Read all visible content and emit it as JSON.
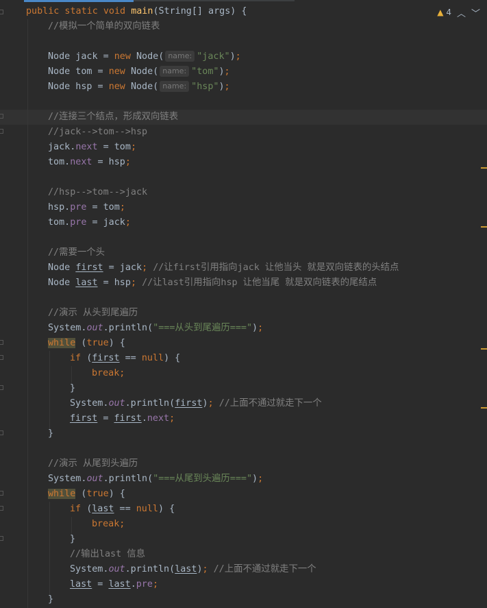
{
  "inspection": {
    "warning_count": "4",
    "warning_icon": "warning-triangle-icon",
    "prev_icon": "chevron-up-icon",
    "next_icon": "chevron-down-icon"
  },
  "code": {
    "l01_sig": "public static void main(String[] args) {",
    "l02": "//模拟一个简单的双向链表",
    "jack_decl": "Node jack = new Node(",
    "tom_decl": "Node tom = new Node(",
    "hsp_decl": "Node hsp = new Node(",
    "param_hint": "name:",
    "jack_str": "\"jack\"",
    "tom_str": "\"tom\"",
    "hsp_str": "\"hsp\"",
    "c_link": "//连接三个结点，形成双向链表",
    "c_forward": "//jack-->tom-->hsp",
    "c_backward": "//hsp-->tom-->jack",
    "c_head": "//需要一个头",
    "c_first": "//让first引用指向jack 让他当头 就是双向链表的头结点",
    "c_last": "//让last引用指向hsp 让他当尾 就是双向链表的尾结点",
    "c_demo1": "//演示 从头到尾遍历",
    "c_demo2": "//演示 从尾到头遍历",
    "str_head_to_tail": "\"===从头到尾遍历===\"",
    "str_tail_to_head": "\"===从尾到头遍历===\"",
    "c_next": "//上面不通过就走下一个",
    "c_print_last": "//输出last 信息"
  },
  "colors": {
    "background": "#2b2b2b",
    "keyword": "#cc7832",
    "method": "#ffc66d",
    "string": "#6a8759",
    "comment": "#808080",
    "field": "#9876aa",
    "text": "#a9b7c6",
    "warning": "#e8b03a"
  }
}
